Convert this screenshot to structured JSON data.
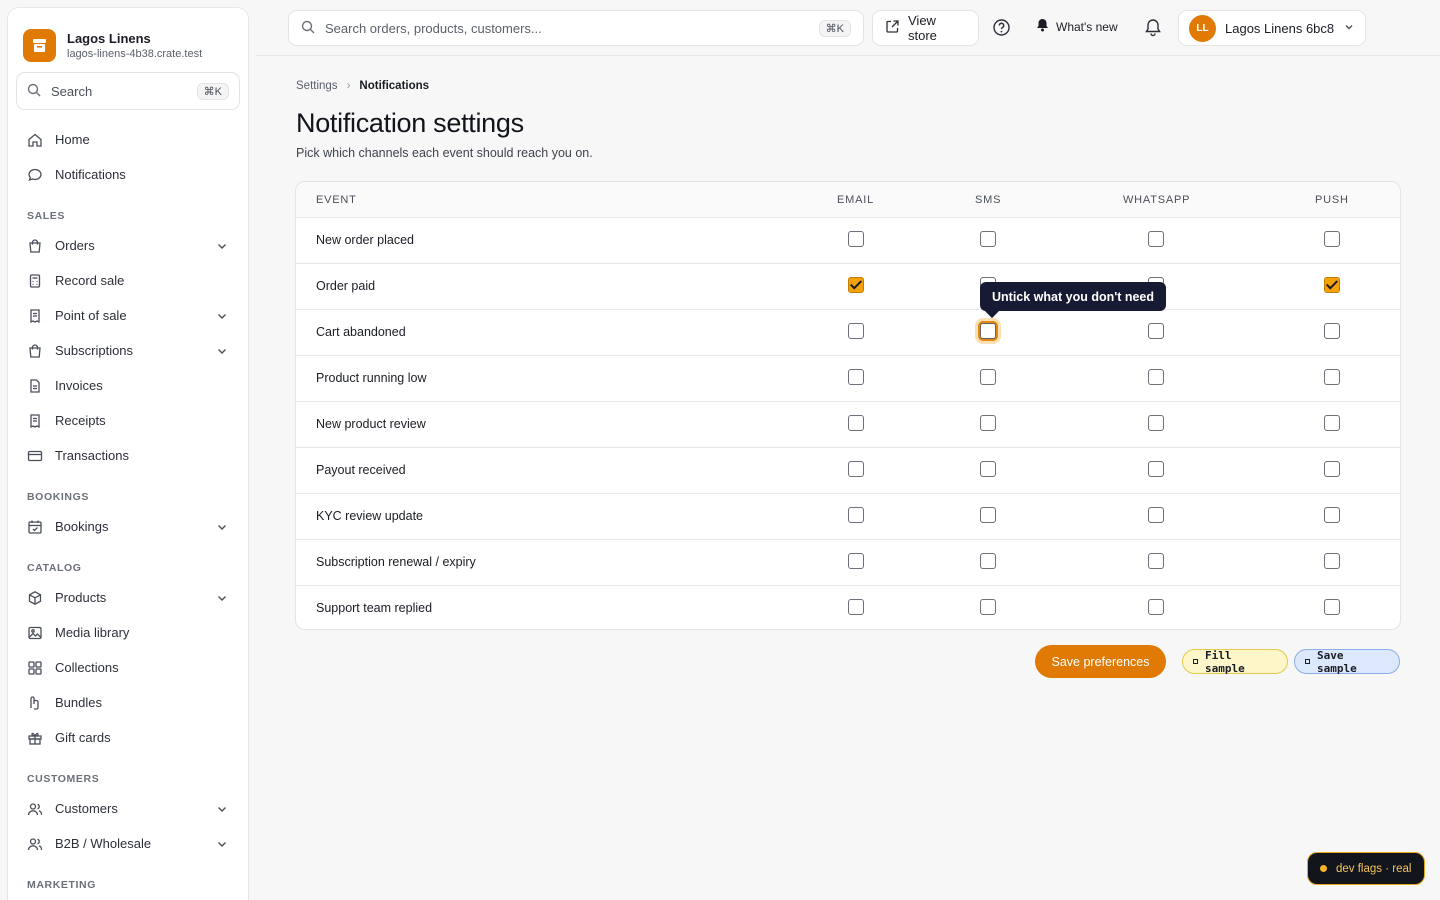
{
  "brand": {
    "name": "Lagos Linens",
    "domain": "lagos-linens-4b38.crate.test"
  },
  "sidebar": {
    "search_label": "Search",
    "search_kbd": "⌘K",
    "top_items": [
      {
        "label": "Home",
        "icon": "home-icon"
      },
      {
        "label": "Notifications",
        "icon": "chat-bubble-icon"
      }
    ],
    "sections": [
      {
        "label": "SALES",
        "items": [
          {
            "label": "Orders",
            "icon": "bag-icon",
            "expandable": true
          },
          {
            "label": "Record sale",
            "icon": "calculator-icon",
            "expandable": false
          },
          {
            "label": "Point of sale",
            "icon": "receipt-icon",
            "expandable": true
          },
          {
            "label": "Subscriptions",
            "icon": "bag-icon",
            "expandable": true
          },
          {
            "label": "Invoices",
            "icon": "document-icon",
            "expandable": false
          },
          {
            "label": "Receipts",
            "icon": "receipt-icon",
            "expandable": false
          },
          {
            "label": "Transactions",
            "icon": "card-icon",
            "expandable": false
          }
        ]
      },
      {
        "label": "BOOKINGS",
        "items": [
          {
            "label": "Bookings",
            "icon": "calendar-icon",
            "expandable": true
          }
        ]
      },
      {
        "label": "CATALOG",
        "items": [
          {
            "label": "Products",
            "icon": "box-icon",
            "expandable": true
          },
          {
            "label": "Media library",
            "icon": "image-icon",
            "expandable": false
          },
          {
            "label": "Collections",
            "icon": "grid-icon",
            "expandable": false
          },
          {
            "label": "Bundles",
            "icon": "bundle-icon",
            "expandable": false
          },
          {
            "label": "Gift cards",
            "icon": "gift-icon",
            "expandable": false
          }
        ]
      },
      {
        "label": "CUSTOMERS",
        "items": [
          {
            "label": "Customers",
            "icon": "users-icon",
            "expandable": true
          },
          {
            "label": "B2B / Wholesale",
            "icon": "users-icon",
            "expandable": true
          }
        ]
      },
      {
        "label": "MARKETING",
        "items": []
      }
    ]
  },
  "topbar": {
    "search_placeholder": "Search orders, products, customers...",
    "search_kbd": "⌘K",
    "view_store": "View store",
    "whats_new": "What's new",
    "account_initials": "LL",
    "account_name": "Lagos Linens 6bc8"
  },
  "breadcrumb": {
    "parent": "Settings",
    "current": "Notifications"
  },
  "page": {
    "title": "Notification settings",
    "subtitle": "Pick which channels each event should reach you on."
  },
  "table": {
    "columns": [
      "EVENT",
      "EMAIL",
      "SMS",
      "WHATSAPP",
      "PUSH"
    ],
    "rows": [
      {
        "event": "New order placed",
        "email": false,
        "sms": false,
        "whatsapp": false,
        "push": false
      },
      {
        "event": "Order paid",
        "email": true,
        "sms": false,
        "whatsapp": false,
        "push": true
      },
      {
        "event": "Cart abandoned",
        "email": false,
        "sms": false,
        "whatsapp": false,
        "push": false
      },
      {
        "event": "Product running low",
        "email": false,
        "sms": false,
        "whatsapp": false,
        "push": false
      },
      {
        "event": "New product review",
        "email": false,
        "sms": false,
        "whatsapp": false,
        "push": false
      },
      {
        "event": "Payout received",
        "email": false,
        "sms": false,
        "whatsapp": false,
        "push": false
      },
      {
        "event": "KYC review update",
        "email": false,
        "sms": false,
        "whatsapp": false,
        "push": false
      },
      {
        "event": "Subscription renewal / expiry",
        "email": false,
        "sms": false,
        "whatsapp": false,
        "push": false
      },
      {
        "event": "Support team replied",
        "email": false,
        "sms": false,
        "whatsapp": false,
        "push": false
      }
    ]
  },
  "tooltip": "Untick what you don't need",
  "actions": {
    "save": "Save preferences",
    "fill_sample": "Fill sample",
    "save_sample": "Save sample"
  },
  "dev_flags": "dev flags · real",
  "colors": {
    "accent": "#e07a05",
    "checked": "#f5a20a",
    "tooltip_bg": "#161a33"
  }
}
